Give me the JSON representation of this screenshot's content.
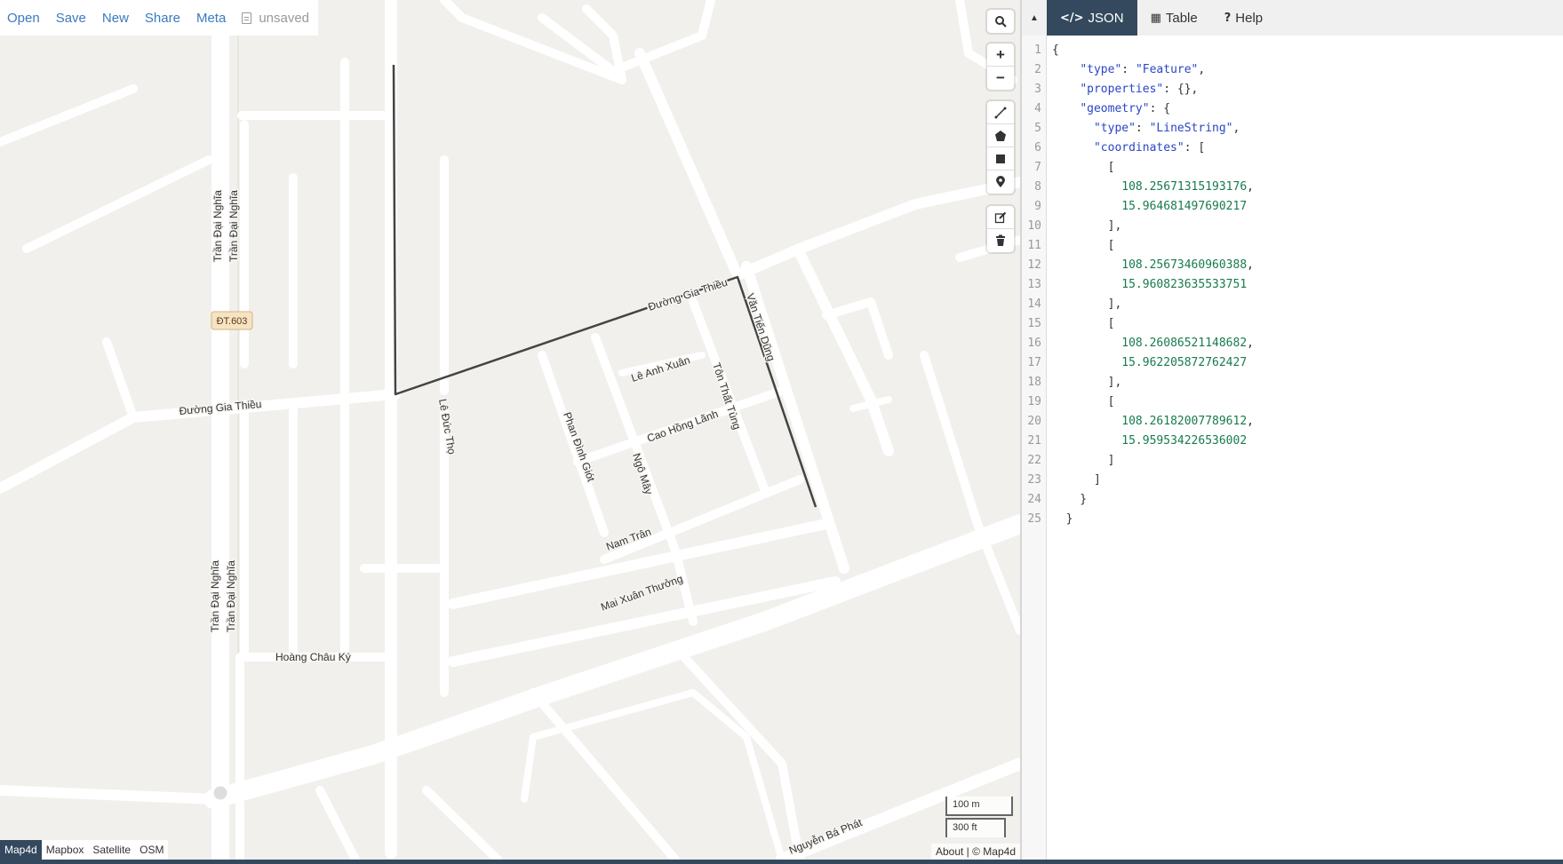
{
  "top_menu": {
    "open": "Open",
    "save": "Save",
    "new": "New",
    "share": "Share",
    "meta": "Meta",
    "file_status": "unsaved"
  },
  "map": {
    "route_shield": "ĐT.603",
    "street_labels": {
      "tran_dai_nghia": "Trần Đại Nghĩa",
      "duong_gia_thieu": "Đường Gia Thiều",
      "le_duc_tho": "Lê Đức Thọ",
      "le_anh_xuan": "Lê Anh Xuân",
      "ton_that_tung": "Tôn Thất Tùng",
      "van_tien_dung": "Văn Tiến Dũng",
      "cao_hong_lanh": "Cao Hồng Lãnh",
      "phan_dinh_giot": "Phan Đình Giót",
      "ngo_may": "Ngô Mây",
      "nam_tran": "Nam Trân",
      "mai_xuan_thuong": "Mai Xuân Thưởng",
      "hoang_chau_ky": "Hoàng Châu Ký",
      "nguyen_ba_phat": "Nguyễn Bá Phát"
    },
    "scale": {
      "metric": "100 m",
      "imperial": "300 ft"
    },
    "attribution": "About | © Map4d",
    "layers": [
      "Map4d",
      "Mapbox",
      "Satellite",
      "OSM"
    ],
    "active_layer": "Map4d",
    "line_color": "#444444"
  },
  "panel": {
    "tabs": [
      {
        "icon": "</>",
        "label": "JSON"
      },
      {
        "icon": "▦",
        "label": "Table"
      },
      {
        "icon": "?",
        "label": "Help"
      }
    ],
    "active_tab": "JSON",
    "accent": "#34495e",
    "code_lines": [
      "{",
      "    \"type\": \"Feature\",",
      "    \"properties\": {},",
      "    \"geometry\": {",
      "      \"type\": \"LineString\",",
      "      \"coordinates\": [",
      "        [",
      "          108.25671315193176,",
      "          15.964681497690217",
      "        ],",
      "        [",
      "          108.25673460960388,",
      "          15.960823635533751",
      "        ],",
      "        [",
      "          108.26086521148682,",
      "          15.962205872762427",
      "        ],",
      "        [",
      "          108.26182007789612,",
      "          15.959534226536002",
      "        ]",
      "      ]",
      "    }",
      "  }"
    ]
  }
}
